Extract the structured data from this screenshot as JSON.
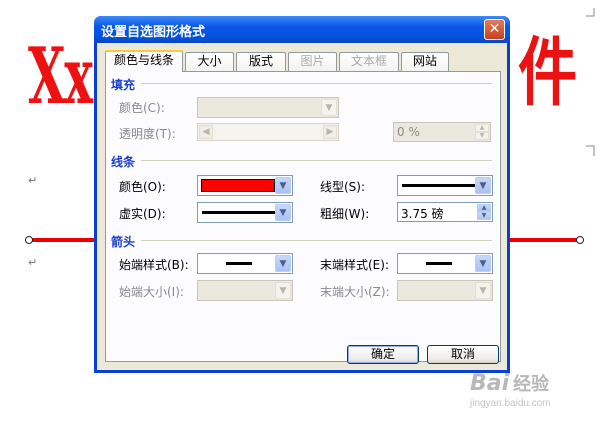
{
  "background": {
    "big_text_left": "Xx",
    "big_text_right": "件",
    "paragraph_mark": "↵",
    "watermark_logo": "Bai",
    "watermark_sub": "经验",
    "watermark_url": "jingyan.baidu.com"
  },
  "dialog": {
    "title": "设置自选图形格式",
    "close_label": "✕",
    "tabs": [
      {
        "label": "颜色与线条",
        "active": true,
        "enabled": true
      },
      {
        "label": "大小",
        "active": false,
        "enabled": true
      },
      {
        "label": "版式",
        "active": false,
        "enabled": true
      },
      {
        "label": "图片",
        "active": false,
        "enabled": false
      },
      {
        "label": "文本框",
        "active": false,
        "enabled": false
      },
      {
        "label": "网站",
        "active": false,
        "enabled": true
      }
    ],
    "fill": {
      "section_title": "填充",
      "color_label": "颜色(C):",
      "transparency_label": "透明度(T):",
      "transparency_value": "0 %"
    },
    "line": {
      "section_title": "线条",
      "color_label": "颜色(O):",
      "color_value": "#ff0000",
      "style_label": "线型(S):",
      "dash_label": "虚实(D):",
      "weight_label": "粗细(W):",
      "weight_value": "3.75 磅"
    },
    "arrows": {
      "section_title": "箭头",
      "begin_style_label": "始端样式(B):",
      "end_style_label": "末端样式(E):",
      "begin_size_label": "始端大小(I):",
      "end_size_label": "末端大小(Z):"
    },
    "buttons": {
      "ok": "确定",
      "cancel": "取消"
    }
  },
  "colors": {
    "accent_title_blue": "#1b3fd0",
    "titlebar_blue": "#0a57e8",
    "line_red": "#ee0000"
  }
}
